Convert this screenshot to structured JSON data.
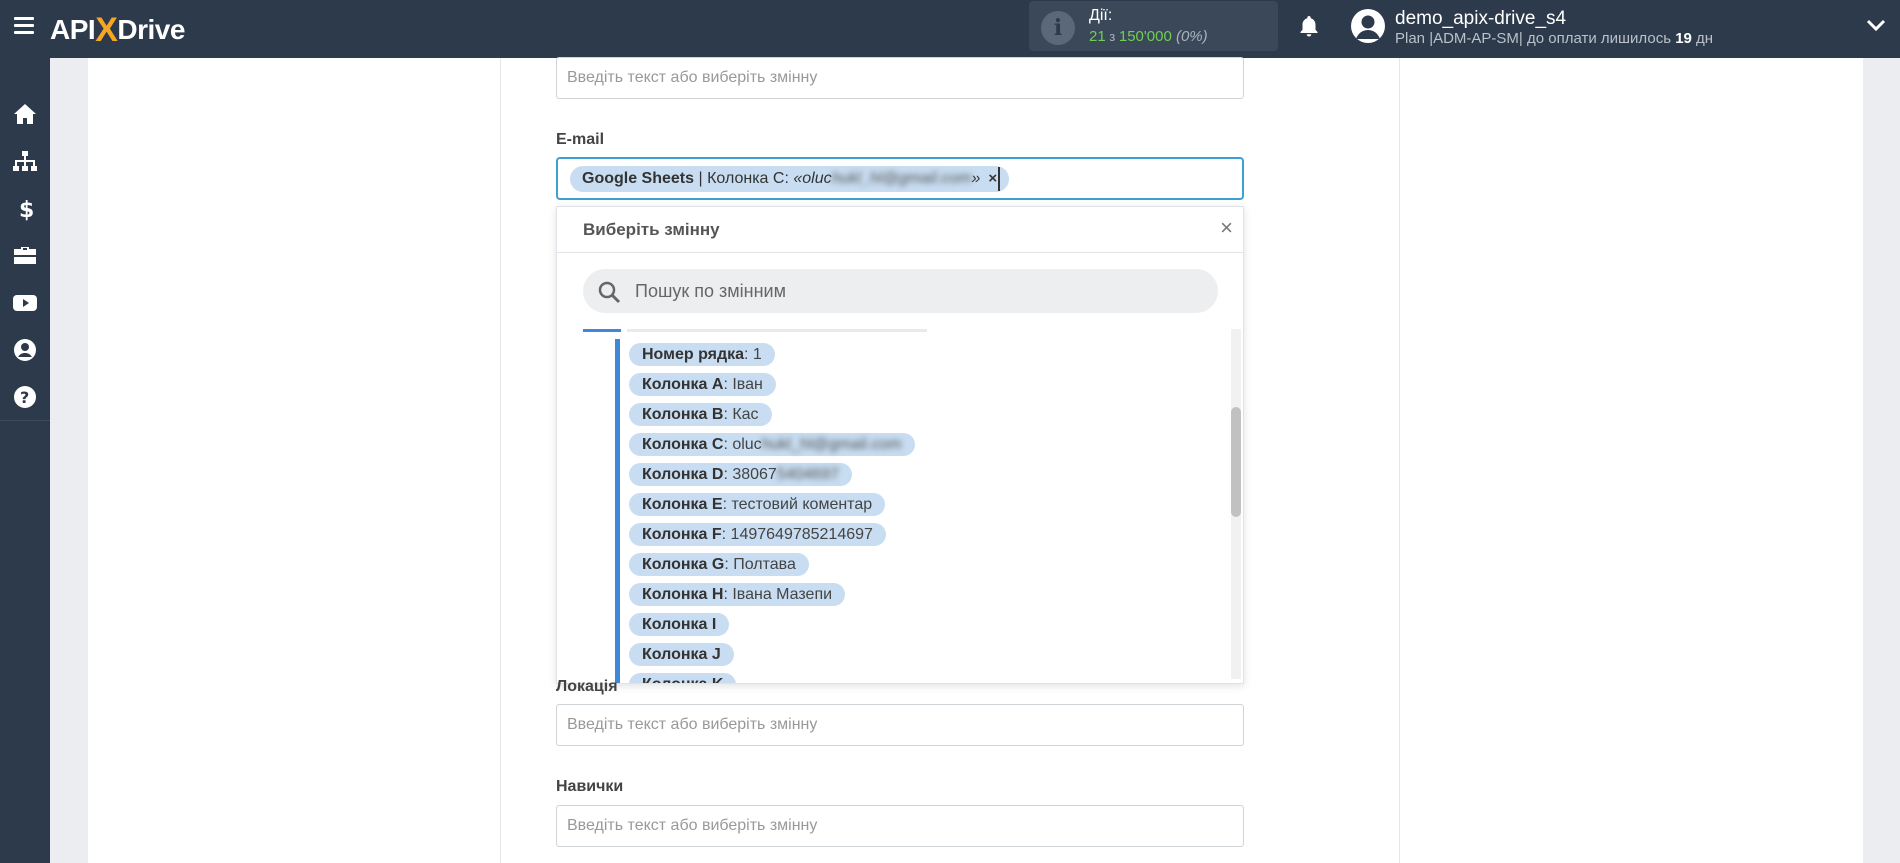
{
  "topbar": {
    "logo_prefix": "API",
    "logo_x": "X",
    "logo_suffix": "Drive",
    "actions_label": "Дії:",
    "actions_used": "21",
    "actions_of": " з ",
    "actions_total": "150'000",
    "actions_pct": "(0%)",
    "user_name": "demo_apix-drive_s4",
    "plan_text": "Plan |ADM-AP-SM| до оплати лишилось ",
    "plan_days": "19",
    "plan_days_unit": " дн"
  },
  "sidebar": {
    "icons": [
      "home-icon",
      "sitemap-icon",
      "dollar-icon",
      "briefcase-icon",
      "youtube-icon",
      "user-circle-icon",
      "help-icon"
    ]
  },
  "form": {
    "top_input_placeholder": "Введіть текст або виберіть змінну",
    "email_label": "E-mail",
    "email_chip": {
      "source": "Google Sheets",
      "separator": " | Колонка C: ",
      "value_prefix": "«oluc",
      "value_blurred": "hukl_hl@gmail.com",
      "value_suffix": "»",
      "close": "×"
    },
    "location_label": "Локація",
    "location_placeholder": "Введіть текст або виберіть змінну",
    "skills_label": "Навички",
    "skills_placeholder": "Введіть текст або виберіть змінну"
  },
  "dropdown": {
    "title": "Виберіть змінну",
    "close": "×",
    "search_placeholder": "Пошук по змінним",
    "items": [
      {
        "key": "Номер рядка",
        "sep": ": ",
        "value": "1",
        "blur": ""
      },
      {
        "key": "Колонка A",
        "sep": ": ",
        "value": "Іван",
        "blur": ""
      },
      {
        "key": "Колонка B",
        "sep": ": ",
        "value": "Кас",
        "blur": ""
      },
      {
        "key": "Колонка C",
        "sep": ": ",
        "value": "oluc",
        "blur": "hukl_hl@gmail.com"
      },
      {
        "key": "Колонка D",
        "sep": ": ",
        "value": "38067",
        "blur": "5404697"
      },
      {
        "key": "Колонка E",
        "sep": ": ",
        "value": "тестовий коментар",
        "blur": ""
      },
      {
        "key": "Колонка F",
        "sep": ": ",
        "value": "1497649785214697",
        "blur": ""
      },
      {
        "key": "Колонка G",
        "sep": ": ",
        "value": "Полтава",
        "blur": ""
      },
      {
        "key": "Колонка H",
        "sep": ": ",
        "value": "Івана Мазепи",
        "blur": ""
      },
      {
        "key": "Колонка I",
        "sep": "",
        "value": "",
        "blur": ""
      },
      {
        "key": "Колонка J",
        "sep": "",
        "value": "",
        "blur": ""
      },
      {
        "key": "Колонка K",
        "sep": "",
        "value": "",
        "blur": ""
      }
    ]
  },
  "colors": {
    "topbar_bg": "#2c3a4b",
    "accent": "#f6a623",
    "chip_bg": "#c8ddf1",
    "focus_border": "#3d9fd4",
    "actions_green": "#6fcf52"
  }
}
